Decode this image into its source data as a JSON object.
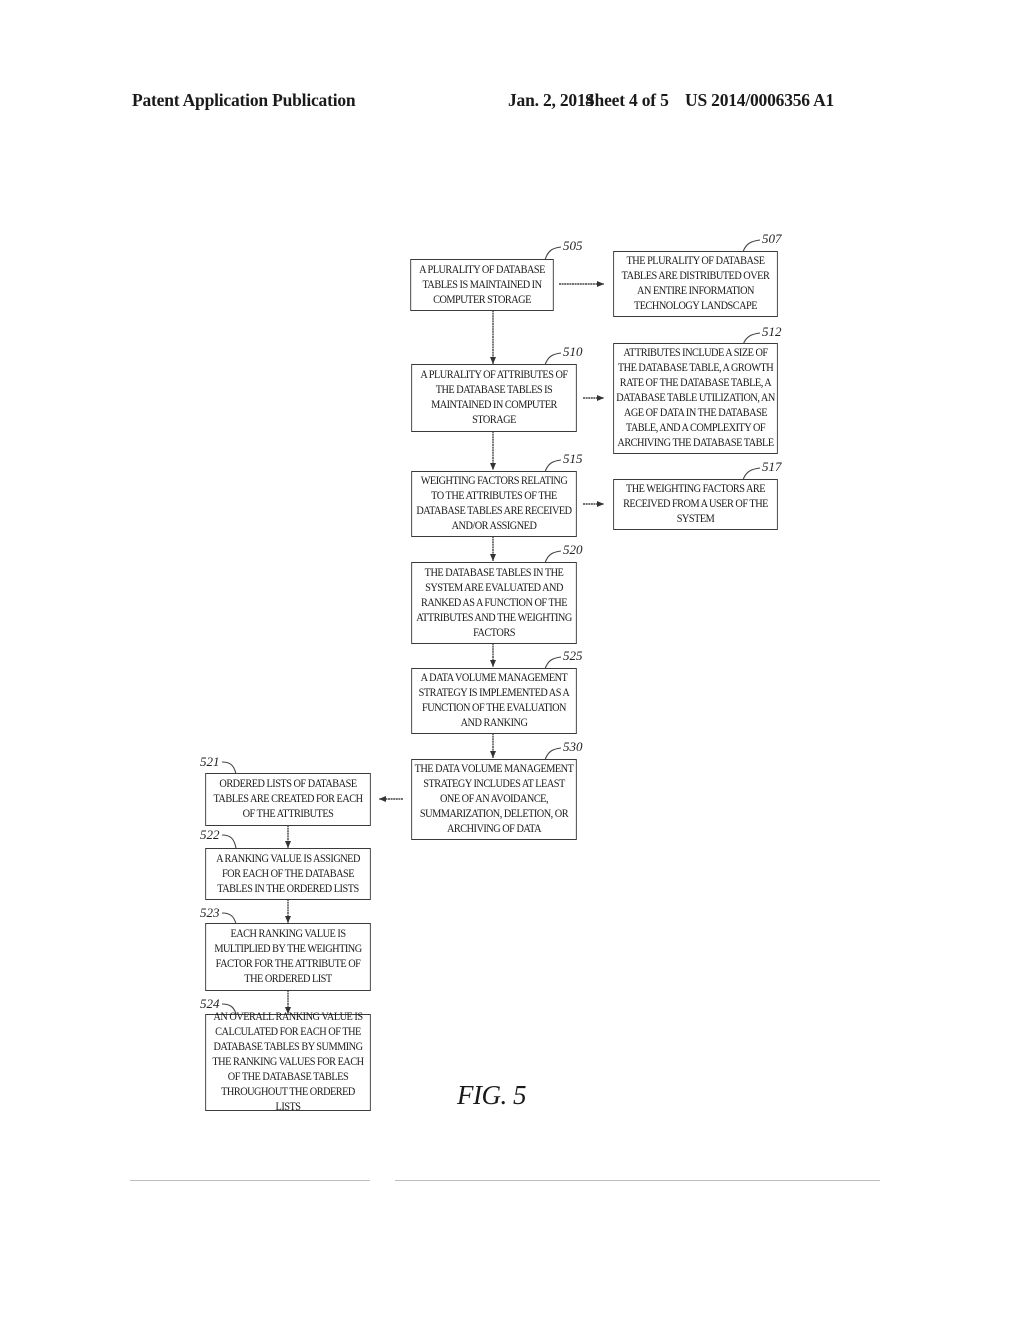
{
  "header": {
    "title": "Patent Application Publication",
    "date": "Jan. 2, 2014",
    "sheet": "Sheet 4 of 5",
    "publication_number": "US 2014/0006356 A1"
  },
  "figure_label": "FIG. 5",
  "steps": {
    "s505": {
      "ref": "505",
      "text": "A plurality of database tables is maintained in computer storage"
    },
    "s507": {
      "ref": "507",
      "text": "The plurality of database tables are distributed over an entire information technology landscape"
    },
    "s510": {
      "ref": "510",
      "text": "A plurality of attributes of the database tables is maintained in computer storage"
    },
    "s512": {
      "ref": "512",
      "text": "Attributes include a size of the database table, a growth rate of the database table, a database table utilization, an age of data in the database table, and a complexity of archiving the database table"
    },
    "s515": {
      "ref": "515",
      "text": "Weighting factors relating to the attributes of the database tables are received and/or assigned"
    },
    "s517": {
      "ref": "517",
      "text": "The weighting factors are received from a user of the system"
    },
    "s520": {
      "ref": "520",
      "text": "The database tables in the system are evaluated and ranked as a function of the attributes and the weighting factors"
    },
    "s525": {
      "ref": "525",
      "text": "A data volume management strategy is implemented as a function of the evaluation and ranking"
    },
    "s530": {
      "ref": "530",
      "text": "The data volume management strategy includes at least one of an avoidance, summarization, deletion, or archiving of data"
    },
    "s521": {
      "ref": "521",
      "text": "Ordered lists of database tables are created for each of the attributes"
    },
    "s522": {
      "ref": "522",
      "text": "A ranking value is assigned for each of the database tables in the ordered lists"
    },
    "s523": {
      "ref": "523",
      "text": "Each ranking value is multiplied by the weighting factor for the attribute of the ordered list"
    },
    "s524": {
      "ref": "524",
      "text": "An overall ranking value is calculated for each of the database tables by summing the ranking values for each of the database tables throughout the ordered lists"
    }
  },
  "connections": [
    {
      "from": "505",
      "to": "507"
    },
    {
      "from": "505",
      "to": "510"
    },
    {
      "from": "510",
      "to": "512"
    },
    {
      "from": "510",
      "to": "515"
    },
    {
      "from": "515",
      "to": "517"
    },
    {
      "from": "515",
      "to": "520"
    },
    {
      "from": "520",
      "to": "525"
    },
    {
      "from": "525",
      "to": "530"
    },
    {
      "from": "530",
      "to": "521"
    },
    {
      "from": "521",
      "to": "522"
    },
    {
      "from": "522",
      "to": "523"
    },
    {
      "from": "523",
      "to": "524"
    }
  ]
}
